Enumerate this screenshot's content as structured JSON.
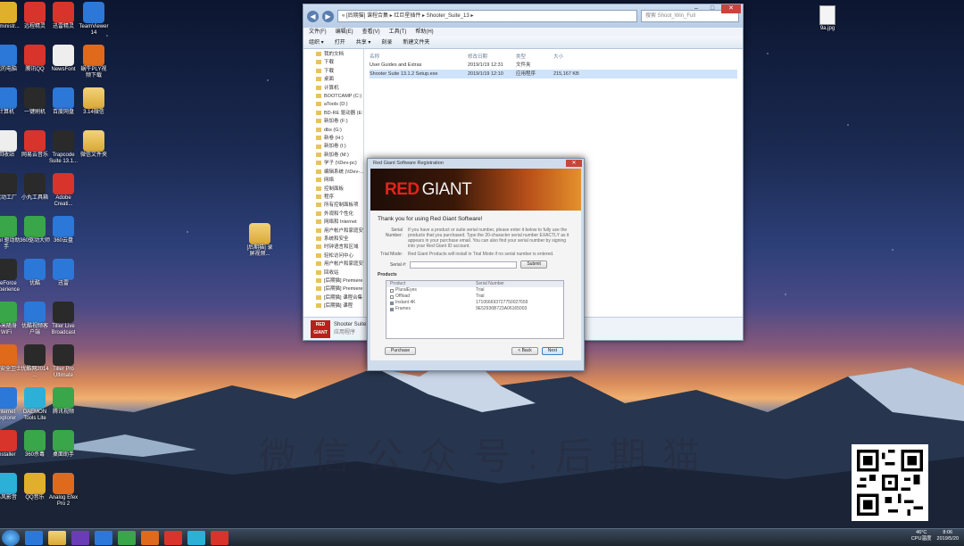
{
  "desktop_icons": [
    {
      "label": "Administr...",
      "color": "ic-yellow",
      "icon": "user-folder-icon"
    },
    {
      "label": "我的电脑",
      "color": "ic-blue",
      "icon": "computer-icon"
    },
    {
      "label": "计算机",
      "color": "ic-blue",
      "icon": "computer-icon"
    },
    {
      "label": "回收站",
      "color": "ic-white",
      "icon": "recycle-bin-icon"
    },
    {
      "label": "驱动工厂",
      "color": "ic-dark",
      "icon": "app-icon"
    },
    {
      "label": "Intel 驱动助手",
      "color": "ic-green",
      "icon": "app-icon"
    },
    {
      "label": "GeForce Experience",
      "color": "ic-dark",
      "icon": "nvidia-icon"
    },
    {
      "label": "小米随身WiFi",
      "color": "ic-green",
      "icon": "app-icon"
    },
    {
      "label": "360安全卫士",
      "color": "ic-orange",
      "icon": "app-icon"
    },
    {
      "label": "Internet Explorer",
      "color": "ic-blue",
      "icon": "ie-icon"
    },
    {
      "label": "Installer",
      "color": "ic-red",
      "icon": "installer-icon"
    },
    {
      "label": "暴风影音",
      "color": "ic-cyan",
      "icon": "app-icon"
    },
    {
      "label": "远程精灵",
      "color": "ic-red",
      "icon": "app-icon"
    },
    {
      "label": "腾讯QQ",
      "color": "ic-red",
      "icon": "qq-icon"
    },
    {
      "label": "一键刷机",
      "color": "ic-dark",
      "icon": "app-icon"
    },
    {
      "label": "网易云音乐",
      "color": "ic-red",
      "icon": "netease-music-icon"
    },
    {
      "label": "小丸工具箱",
      "color": "ic-dark",
      "icon": "app-icon"
    },
    {
      "label": "360驱动大师",
      "color": "ic-green",
      "icon": "app-icon"
    },
    {
      "label": "优酷",
      "color": "ic-blue",
      "icon": "app-icon"
    },
    {
      "label": "优酷视频客户端",
      "color": "ic-blue",
      "icon": "youku-icon"
    },
    {
      "label": "优酷网2014 ...",
      "color": "ic-dark",
      "icon": "app-icon"
    },
    {
      "label": "DAEMON Tools Lite",
      "color": "ic-cyan",
      "icon": "daemon-icon"
    },
    {
      "label": "360杀毒",
      "color": "ic-green",
      "icon": "shield-icon"
    },
    {
      "label": "QQ音乐",
      "color": "ic-yellow",
      "icon": "qq-music-icon"
    },
    {
      "label": "迅雷精灵",
      "color": "ic-red",
      "icon": "app-icon"
    },
    {
      "label": "NewsFont",
      "color": "ic-white",
      "icon": "font-icon"
    },
    {
      "label": "百度网盘",
      "color": "ic-blue",
      "icon": "cloud-icon"
    },
    {
      "label": "Trapcode Suite 13.1...",
      "color": "ic-dark",
      "icon": "trapcode-icon"
    },
    {
      "label": "Adobe Creati...",
      "color": "ic-red",
      "icon": "adobe-icon"
    },
    {
      "label": "360云盘",
      "color": "ic-blue",
      "icon": "cloud-icon"
    },
    {
      "label": "迅雷",
      "color": "ic-blue",
      "icon": "app-icon"
    },
    {
      "label": "Tiller Live Broadcast",
      "color": "ic-dark",
      "icon": "app-icon"
    },
    {
      "label": "Tiller Pro Ultimate",
      "color": "ic-dark",
      "icon": "app-icon"
    },
    {
      "label": "腾讯视频",
      "color": "ic-green",
      "icon": "video-icon"
    },
    {
      "label": "桌面助手",
      "color": "ic-green",
      "icon": "app-icon"
    },
    {
      "label": "Analog Efex Pro 2",
      "color": "ic-orange",
      "icon": "app-icon"
    },
    {
      "label": "TeamViewer 14",
      "color": "ic-blue",
      "icon": "teamviewer-icon"
    },
    {
      "label": "蜗牛PLY视频下载",
      "color": "ic-orange",
      "icon": "app-icon"
    },
    {
      "label": "3.14微信",
      "color": "folder",
      "icon": "folder-icon"
    },
    {
      "label": "微信文件夹",
      "color": "folder",
      "icon": "folder-icon"
    }
  ],
  "desktop_folder": {
    "label": "[后期猫] 录屏视频..."
  },
  "jpg_file": {
    "label": "9a.jpg"
  },
  "explorer": {
    "address": "« [后期猫] 课程合集 ▸ 红巨星插件 ▸ Shooter_Suite_13 ▸",
    "search_placeholder": "搜索 Shoot_Win_Full",
    "menu": [
      "文件(F)",
      "编辑(E)",
      "查看(V)",
      "工具(T)",
      "帮助(H)"
    ],
    "toolbar": [
      "组织 ▾",
      "打开",
      "共享 ▾",
      "刻录",
      "新建文件夹"
    ],
    "tree": [
      "我的文档",
      "下载",
      "下载",
      "桌面",
      "计算机",
      "BOOTCAMP (C:)",
      "aTools (D:)",
      "BD-RE 驱动器 (E:)",
      "新加卷 (F:)",
      "dbs (G:)",
      "新卷 (H:)",
      "新加卷 (I:)",
      "新加卷 (M:)",
      "学子 (\\\\Dev-pc)",
      "编辑系统 (\\\\Dev-...)",
      "网络",
      "控制面板",
      "程序",
      "所有控制面板项",
      "外观和个性化",
      "网络和 Internet",
      "用户帐户和家庭安全",
      "系统和安全",
      "时钟语言和区域",
      "轻松访问中心",
      "用户帐户和家庭安全",
      "回收站",
      "[后期猫] Premiere",
      "[后期猫] Premiere",
      "[后期猫] 课程合集",
      "[后期猫] 课程"
    ],
    "columns": [
      "名称",
      "修改日期",
      "类型",
      "大小"
    ],
    "files": [
      {
        "name": "User Guides and Extras",
        "date": "2019/1/19 12:31",
        "type": "文件夹",
        "size": ""
      },
      {
        "name": "Shooter Suite 13.1.2 Setup.exe",
        "date": "2019/1/19 12:10",
        "type": "应用程序",
        "size": "215,167 KB"
      }
    ],
    "status_name": "Shooter Suite 13.1.2 Setup.exe",
    "status_type": "应用程序"
  },
  "dialog": {
    "title": "Red Giant Software Registration",
    "logo_red": "RED",
    "logo_giant": "GIANT",
    "thanks": "Thank you for using Red Giant Software!",
    "serial_label": "Serial Number:",
    "serial_text": "If you have a product or suite serial number, please enter it below to fully use the products that you purchased. Type the 20-character serial number EXACTLY as it appears in your purchase email. You can also find your serial number by signing into your Red Giant ID account.",
    "trial_label": "Trial Mode:",
    "trial_text": "Red Giant Products will install in Trial Mode if no serial number is entered.",
    "serial_field_label": "Serial #:",
    "submit": "Submit",
    "products_label": "Products",
    "product_columns": [
      "Product",
      "Serial Number"
    ],
    "products": [
      {
        "name": "PluralEyes",
        "serial": "Trial",
        "checked": false
      },
      {
        "name": "Offload",
        "serial": "Trial",
        "checked": false
      },
      {
        "name": "Instant 4K",
        "serial": "171066693727750027659",
        "checked": true
      },
      {
        "name": "Frames",
        "serial": "9E52936B723A06165003",
        "checked": true
      }
    ],
    "purchase": "Purchase",
    "back": "< Back",
    "next": "Next"
  },
  "watermark": "微信公众号:后期猫",
  "tray": {
    "temp": "46°C",
    "cpu": "CPU温度",
    "time": "8:06",
    "date": "2019/5/20"
  }
}
